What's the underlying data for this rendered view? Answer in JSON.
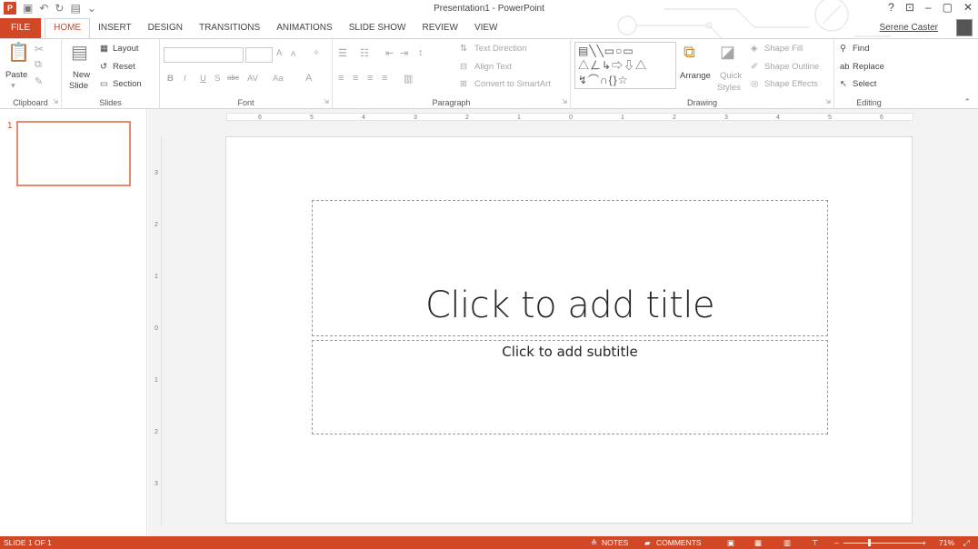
{
  "window": {
    "title": "Presentation1 - PowerPoint",
    "controls": [
      "?",
      "⊡",
      "–",
      "▢",
      "✕"
    ]
  },
  "tabs": [
    {
      "label": "FILE"
    },
    {
      "label": "HOME"
    },
    {
      "label": "INSERT"
    },
    {
      "label": "DESIGN"
    },
    {
      "label": "TRANSITIONS"
    },
    {
      "label": "ANIMATIONS"
    },
    {
      "label": "SLIDE SHOW"
    },
    {
      "label": "REVIEW"
    },
    {
      "label": "VIEW"
    }
  ],
  "user": {
    "name": "Serene Caster"
  },
  "ribbon": {
    "clipboard": {
      "label": "Clipboard",
      "paste": "Paste"
    },
    "slides": {
      "label": "Slides",
      "new_slide": "New",
      "new_slide2": "Slide",
      "layout": "Layout",
      "reset": "Reset",
      "section": "Section"
    },
    "font": {
      "label": "Font",
      "bold": "B",
      "italic": "I",
      "underline": "U",
      "shadow": "S",
      "strike": "abc",
      "spacing": "AV",
      "case": "Aa",
      "color": "A",
      "grow": "A",
      "shrink": "A"
    },
    "paragraph": {
      "label": "Paragraph",
      "text_direction": "Text Direction",
      "align_text": "Align Text",
      "smartart": "Convert to SmartArt"
    },
    "drawing": {
      "label": "Drawing",
      "arrange": "Arrange",
      "quick": "Quick",
      "styles": "Styles",
      "shape_fill": "Shape Fill",
      "shape_outline": "Shape Outline",
      "shape_effects": "Shape Effects"
    },
    "editing": {
      "label": "Editing",
      "find": "Find",
      "replace": "Replace",
      "select": "Select"
    }
  },
  "thumbnail": {
    "number": "1"
  },
  "ruler": {
    "h": [
      "6",
      "5",
      "4",
      "3",
      "2",
      "1",
      "0",
      "1",
      "2",
      "3",
      "4",
      "5",
      "6"
    ],
    "v": [
      "3",
      "2",
      "1",
      "0",
      "1",
      "2",
      "3"
    ]
  },
  "slide": {
    "title_placeholder": "Click to add title",
    "subtitle_placeholder": "Click to add subtitle"
  },
  "status": {
    "slide_info": "SLIDE 1 OF 1",
    "notes": "NOTES",
    "comments": "COMMENTS",
    "zoom": "71%"
  },
  "colors": {
    "accent": "#d24726"
  }
}
